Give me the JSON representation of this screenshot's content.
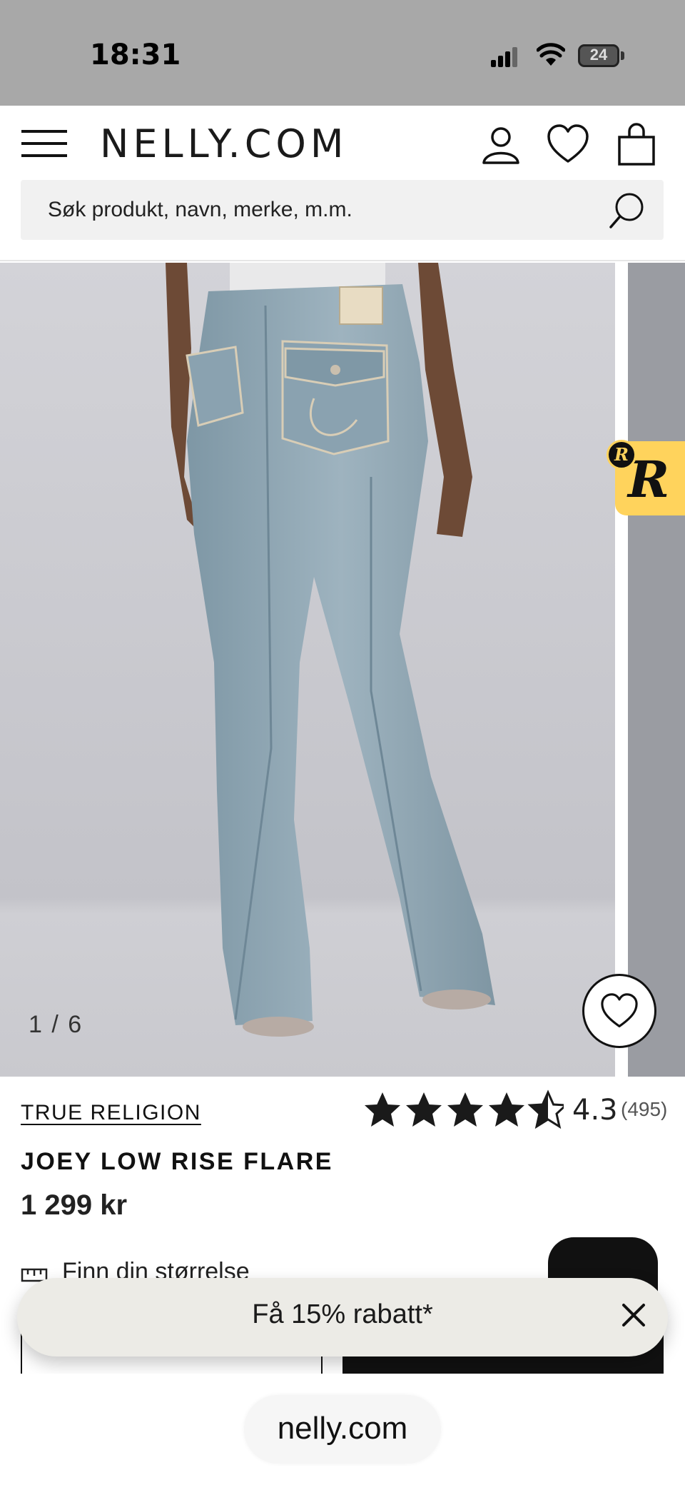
{
  "status_bar": {
    "time": "18:31",
    "battery": "24",
    "icons": [
      "signal-icon",
      "wifi-icon",
      "battery-icon"
    ]
  },
  "header": {
    "logo": "NELLY.COM",
    "icons": [
      "menu-icon",
      "account-icon",
      "wishlist-icon",
      "cart-icon"
    ],
    "search": {
      "placeholder": "Søk produkt, navn, merke, m.m.",
      "value": ""
    }
  },
  "gallery": {
    "counter": "1 / 6",
    "image_alt": "Back view of light blue flared jeans",
    "favorite_icon": "heart-icon",
    "badge_letters": {
      "small": "R",
      "large": "R"
    }
  },
  "product": {
    "brand": "TRUE RELIGION",
    "name": "JOEY LOW RISE FLARE",
    "price": "1 299 kr",
    "rating": {
      "value": "4.3",
      "count": "(495)",
      "stars": 4.5
    },
    "size_guide": "Finn din størrelse"
  },
  "discount_banner": {
    "text": "Få 15% rabatt*"
  },
  "browser": {
    "url": "nelly.com"
  },
  "colors": {
    "status_bar": "#a8a8a8",
    "search_bg": "#f1f1f1",
    "banner_bg": "#ecebe6",
    "badge": "#ffd35c",
    "denim": "#8fa7b4"
  }
}
